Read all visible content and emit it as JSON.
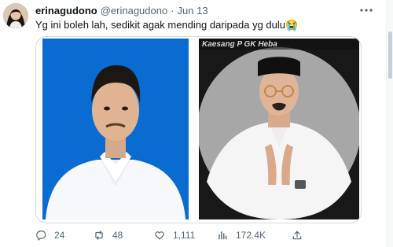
{
  "tweet": {
    "author_name": "erinagudono",
    "author_handle": "@erinagudono",
    "separator": "·",
    "date": "Jun 13",
    "text": "Yg ini boleh lah, sedikit agak mending daripada yg dulu😭",
    "more_icon": "more-dots-icon",
    "overlay_text": "Kaesang P          GK Heba"
  },
  "actions": {
    "replies": "24",
    "retweets": "48",
    "likes": "1,111",
    "views": "172.4K",
    "icons": [
      "reply-icon",
      "retweet-icon",
      "like-icon",
      "views-icon",
      "share-icon"
    ]
  },
  "colors": {
    "blue_background": "#0a6bd1",
    "gray_frame": "#a7a7a7",
    "text_secondary": "#536471",
    "border": "#cfd9de"
  }
}
